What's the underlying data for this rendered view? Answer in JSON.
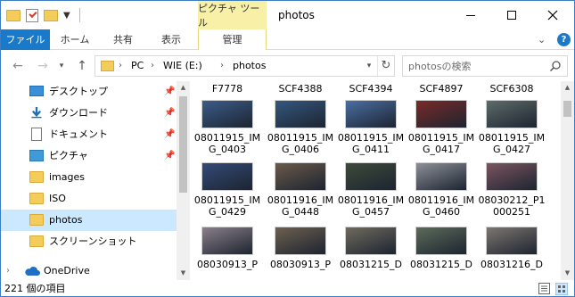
{
  "window": {
    "title": "photos"
  },
  "ribbon": {
    "context_group": "ピクチャ ツール",
    "tabs": {
      "file": "ファイル",
      "home": "ホーム",
      "share": "共有",
      "view": "表示",
      "manage": "管理"
    },
    "help": "?"
  },
  "address": {
    "crumbs": [
      "PC",
      "WIE (E:)",
      "photos"
    ],
    "search_placeholder": "photosの検索"
  },
  "nav": {
    "items": [
      {
        "label": "デスクトップ",
        "icon": "desktop-icon",
        "pinned": true
      },
      {
        "label": "ダウンロード",
        "icon": "download-icon",
        "pinned": true
      },
      {
        "label": "ドキュメント",
        "icon": "document-icon",
        "pinned": true
      },
      {
        "label": "ピクチャ",
        "icon": "pictures-icon",
        "pinned": true
      },
      {
        "label": "images",
        "icon": "folder-icon",
        "pinned": false
      },
      {
        "label": "ISO",
        "icon": "folder-icon",
        "pinned": false
      },
      {
        "label": "photos",
        "icon": "folder-icon",
        "pinned": false,
        "selected": true
      },
      {
        "label": "スクリーンショット",
        "icon": "folder-icon",
        "pinned": false
      },
      {
        "label": "OneDrive",
        "icon": "onedrive-icon",
        "pinned": false
      }
    ]
  },
  "files": {
    "top_row": [
      "F7778",
      "SCF4388",
      "SCF4394",
      "SCF4897",
      "SCF6308"
    ],
    "tiles": [
      {
        "name": "08011915_IMG_0403",
        "color": "#3b5c8a"
      },
      {
        "name": "08011915_IMG_0406",
        "color": "#34577f"
      },
      {
        "name": "08011915_IMG_0411",
        "color": "#4a6ea3"
      },
      {
        "name": "08011915_IMG_0417",
        "color": "#7a2a28"
      },
      {
        "name": "08011915_IMG_0427",
        "color": "#5d6b6a"
      },
      {
        "name": "08011915_IMG_0429",
        "color": "#334a78"
      },
      {
        "name": "08011916_IMG_0448",
        "color": "#6a5a4a"
      },
      {
        "name": "08011916_IMG_0457",
        "color": "#3d4a3a"
      },
      {
        "name": "08011916_IMG_0460",
        "color": "#8c8f97"
      },
      {
        "name": "08030212_P1000251",
        "color": "#7a5560"
      },
      {
        "name": "08030913_P",
        "color": "#8a7f89"
      },
      {
        "name": "08030913_P",
        "color": "#6d6050"
      },
      {
        "name": "08031215_D",
        "color": "#6f6a5e"
      },
      {
        "name": "08031215_D",
        "color": "#5c6b5a"
      },
      {
        "name": "08031216_D",
        "color": "#7d7670"
      }
    ]
  },
  "status": {
    "count": "221 個の項目"
  }
}
